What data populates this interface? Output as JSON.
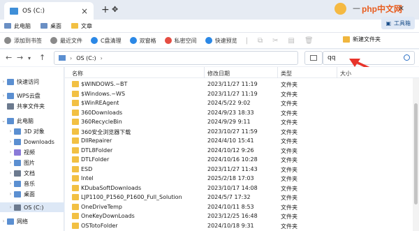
{
  "tab": {
    "title": "OS (C:)",
    "close": "×"
  },
  "titlebar": {
    "new_tab": "+",
    "brand": "php中文网",
    "minimize": "—",
    "maximize": "□",
    "close": "×"
  },
  "favorites": [
    {
      "label": "此电脑",
      "icon": "computer-icon"
    },
    {
      "label": "桌面",
      "icon": "desktop-icon"
    },
    {
      "label": "文章",
      "icon": "folder-icon"
    }
  ],
  "tools_button": "工具箱",
  "commands": [
    {
      "label": "添加到书签",
      "icon": "star-icon"
    },
    {
      "label": "最近文件",
      "icon": "clock-icon"
    },
    {
      "label": "C盘清理",
      "icon": "clean-icon"
    },
    {
      "label": "双窗格",
      "icon": "dual-pane-icon"
    },
    {
      "label": "私密空间",
      "icon": "lock-icon"
    },
    {
      "label": "快速预览",
      "icon": "eye-icon"
    }
  ],
  "new_folder": "新建文件夹",
  "address": {
    "path": "OS (C:)",
    "separator": "›"
  },
  "search": {
    "value": "qq"
  },
  "sidebar": [
    {
      "label": "快速访问",
      "icon": "star-icon"
    },
    {
      "label": "WPS云盘",
      "icon": "cloud-icon"
    },
    {
      "label": "共享文件夹",
      "icon": "shared-folder-icon"
    },
    {
      "label": "此电脑",
      "icon": "computer-icon"
    },
    {
      "label": "3D 对象",
      "icon": "cube-icon"
    },
    {
      "label": "Downloads",
      "icon": "download-icon"
    },
    {
      "label": "视频",
      "icon": "video-icon"
    },
    {
      "label": "图片",
      "icon": "image-icon"
    },
    {
      "label": "文档",
      "icon": "document-icon"
    },
    {
      "label": "音乐",
      "icon": "music-icon"
    },
    {
      "label": "桌面",
      "icon": "desktop-icon"
    },
    {
      "label": "OS (C:)",
      "icon": "drive-icon"
    },
    {
      "label": "网络",
      "icon": "network-icon"
    }
  ],
  "columns": {
    "name": "名称",
    "date": "修改日期",
    "type": "类型",
    "size": "大小"
  },
  "files": [
    {
      "name": "$WINDOWS.~BT",
      "date": "2023/11/27 11:19",
      "type": "文件夹"
    },
    {
      "name": "$Windows.~WS",
      "date": "2023/11/27 11:19",
      "type": "文件夹"
    },
    {
      "name": "$WinREAgent",
      "date": "2024/5/22 9:02",
      "type": "文件夹"
    },
    {
      "name": "360Downloads",
      "date": "2024/9/23 18:33",
      "type": "文件夹"
    },
    {
      "name": "360RecycleBin",
      "date": "2024/9/29 9:11",
      "type": "文件夹"
    },
    {
      "name": "360安全浏览器下载",
      "date": "2023/10/27 11:59",
      "type": "文件夹"
    },
    {
      "name": "DllRepairer",
      "date": "2024/4/10 15:41",
      "type": "文件夹"
    },
    {
      "name": "DTL8Folder",
      "date": "2024/10/12 9:26",
      "type": "文件夹"
    },
    {
      "name": "DTLFolder",
      "date": "2024/10/16 10:28",
      "type": "文件夹"
    },
    {
      "name": "ESD",
      "date": "2023/11/27 11:43",
      "type": "文件夹"
    },
    {
      "name": "Intel",
      "date": "2025/2/18 17:03",
      "type": "文件夹"
    },
    {
      "name": "KDubaSoftDownloads",
      "date": "2023/10/17 14:08",
      "type": "文件夹"
    },
    {
      "name": "LJP1100_P1560_P1600_Full_Solution",
      "date": "2024/5/7 17:32",
      "type": "文件夹"
    },
    {
      "name": "OneDriveTemp",
      "date": "2024/10/11 8:53",
      "type": "文件夹"
    },
    {
      "name": "OneKeyDownLoads",
      "date": "2023/12/25 16:48",
      "type": "文件夹"
    },
    {
      "name": "OSTotoFolder",
      "date": "2024/10/18 9:31",
      "type": "文件夹"
    }
  ],
  "colors": {
    "accent": "#2b6fc3",
    "folder": "#f2c043",
    "arrow": "#e8332a",
    "brand": "#e85d1f"
  }
}
